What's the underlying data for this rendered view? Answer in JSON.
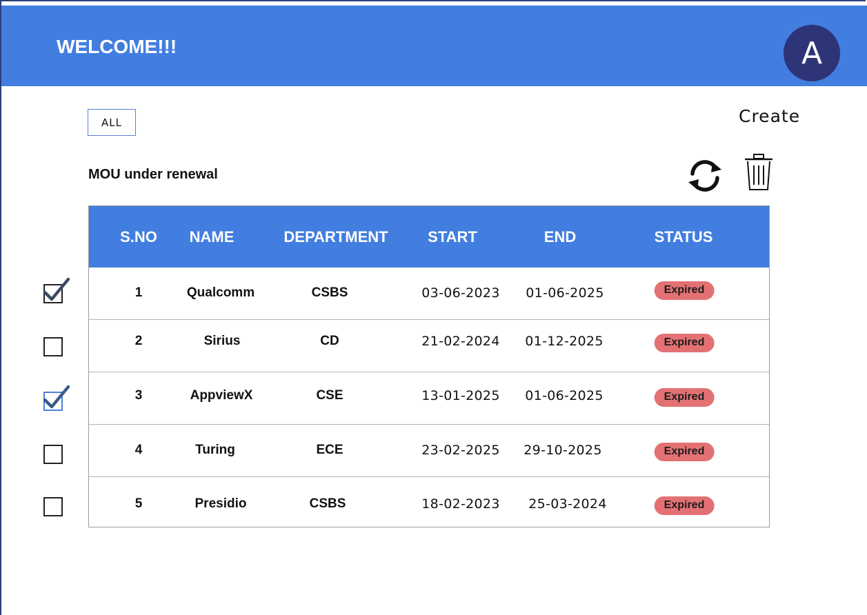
{
  "header": {
    "title": "WELCOME!!!",
    "avatar_initial": "A",
    "bg_color": "#427ee0",
    "avatar_color": "#2d3477"
  },
  "filter": {
    "all_label": "ALL"
  },
  "actions": {
    "create_label": "Create",
    "refresh_icon": "refresh-icon",
    "delete_icon": "trash-icon"
  },
  "section": {
    "title": "MOU under renewal"
  },
  "table": {
    "columns": [
      "S.NO",
      "NAME",
      "DEPARTMENT",
      "START",
      "END",
      "STATUS"
    ],
    "rows": [
      {
        "sno": "1",
        "name": "Qualcomm",
        "department": "CSBS",
        "start": "03-06-2023",
        "end": "01-06-2025",
        "status": "Expired",
        "checked": true
      },
      {
        "sno": "2",
        "name": "Sirius",
        "department": "CD",
        "start": "21-02-2024",
        "end": "01-12-2025",
        "status": "Expired",
        "checked": false
      },
      {
        "sno": "3",
        "name": "AppviewX",
        "department": "CSE",
        "start": "13-01-2025",
        "end": "01-06-2025",
        "status": "Expired",
        "checked": true
      },
      {
        "sno": "4",
        "name": "Turing",
        "department": "ECE",
        "start": "23-02-2025",
        "end": "29-10-2025",
        "status": "Expired",
        "checked": false
      },
      {
        "sno": "5",
        "name": "Presidio",
        "department": "CSBS",
        "start": "18-02-2023",
        "end": "25-03-2024",
        "status": "Expired",
        "checked": false
      }
    ],
    "status_color": "#e37173"
  }
}
